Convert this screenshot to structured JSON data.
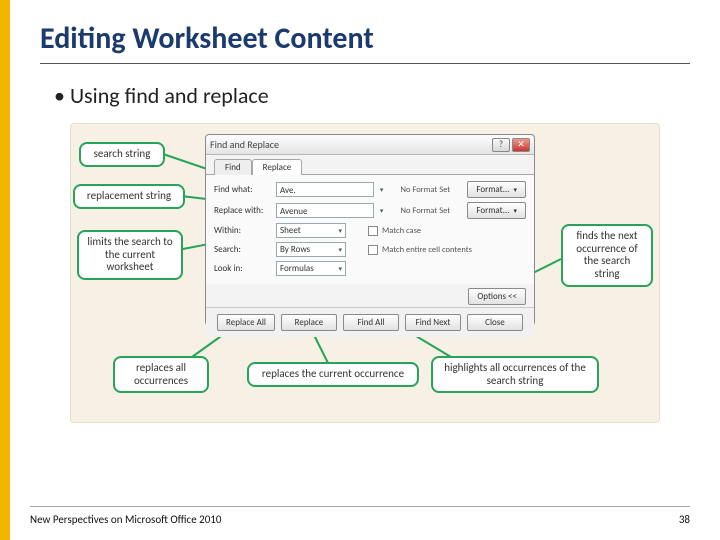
{
  "slide": {
    "title": "Editing Worksheet Content",
    "bullet": "Using find and replace"
  },
  "dialog": {
    "title": "Find and Replace",
    "tabs": {
      "find": "Find",
      "replace": "Replace"
    },
    "labels": {
      "find_what": "Find what:",
      "replace_with": "Replace with:",
      "within": "Within:",
      "search": "Search:",
      "look_in": "Look in:"
    },
    "values": {
      "find_what": "Ave.",
      "replace_with": "Avenue",
      "within": "Sheet",
      "search": "By Rows",
      "look_in": "Formulas"
    },
    "format_info": {
      "find": "No Format Set",
      "replace": "No Format Set"
    },
    "checks": {
      "match_case": "Match case",
      "match_entire": "Match entire cell contents"
    },
    "buttons": {
      "format1": "Format...",
      "format2": "Format...",
      "options": "Options <<",
      "replace_all": "Replace All",
      "replace": "Replace",
      "find_all": "Find All",
      "find_next": "Find Next",
      "close": "Close"
    }
  },
  "callouts": {
    "search_string": "search string",
    "replacement_string": "replacement string",
    "limits_sheet": "limits the search to the current worksheet",
    "replaces_all": "replaces all occurrences",
    "replaces_current": "replaces the current occurrence",
    "highlights_all": "highlights all occurrences of the search string",
    "finds_next": "finds the next occurrence of the search string"
  },
  "footer": {
    "text": "New Perspectives on Microsoft Office 2010",
    "page": "38"
  }
}
